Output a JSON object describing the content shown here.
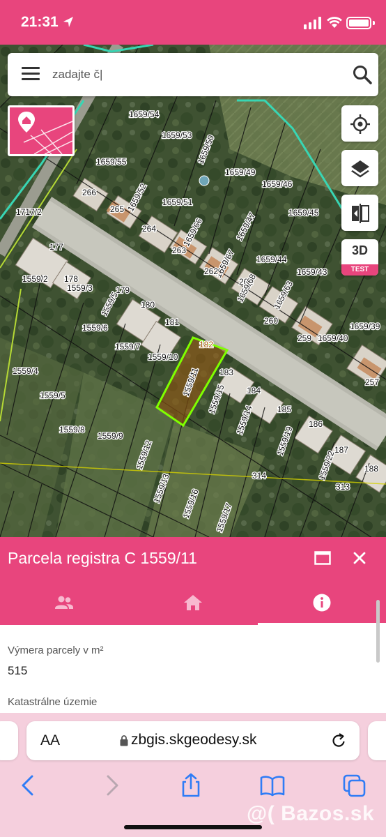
{
  "status_bar": {
    "time": "21:31"
  },
  "search": {
    "value": "zadajte č|",
    "placeholder": "zadajte č|"
  },
  "map": {
    "labels": [
      "1659/54",
      "1659/53",
      "1659/55",
      "1659/50",
      "1659/49",
      "1659/46",
      "1659/52",
      "1659/51",
      "1659/45",
      "1717/2",
      "266",
      "265",
      "264",
      "1659/66",
      "263",
      "1659/47",
      "1659/67",
      "262",
      "261",
      "1659/44",
      "1659/43",
      "177",
      "178",
      "1559/2",
      "1559/3",
      "179",
      "180",
      "1559/5",
      "1659/68",
      "1659/63",
      "260",
      "1659/39",
      "1559/6",
      "181",
      "1559/7",
      "1559/10",
      "182",
      "1559/11",
      "183",
      "259",
      "1659/40",
      "257",
      "1559/4",
      "1559/5",
      "184",
      "1559/14",
      "185",
      "1559/8",
      "1559/9",
      "186",
      "187",
      "188",
      "1559/13",
      "314",
      "313",
      "1559/16",
      "1559/17",
      "1559/12",
      "1559/15",
      "1559/19",
      "1559/22"
    ],
    "tool_3d_label": "3D",
    "tool_3d_badge": "TEST",
    "highlight_color": "#7fff00"
  },
  "panel": {
    "title": "Parcela registra C 1559/11",
    "fields": [
      {
        "label": "Výmera parcely v m²",
        "value": "515"
      },
      {
        "label": "Katastrálne územie",
        "value": ""
      }
    ]
  },
  "browser": {
    "text_size_label": "AA",
    "domain": "zbgis.skgeodesy.sk"
  },
  "watermark": "@( Bazos.sk",
  "colors": {
    "accent": "#e8457d",
    "tab_icon_inactive": "#f8b9cf"
  }
}
